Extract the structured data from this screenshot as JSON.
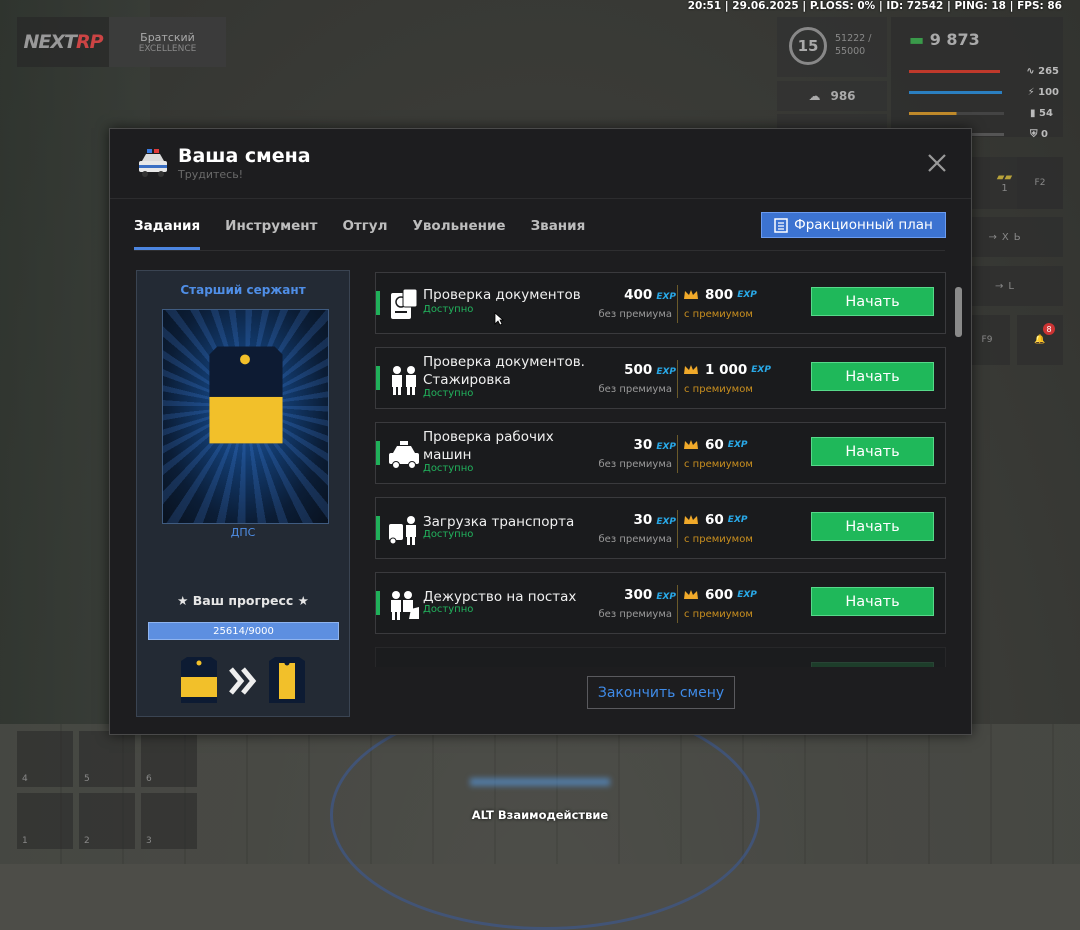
{
  "hud": {
    "top_info": "20:51 | 29.06.2025 | P.LOSS: 0% | ID: 72542 | PING: 18 | FPS: 86",
    "logo": "NEXTRP",
    "server_name": "Братский",
    "server_sub": "EXCELLENCE",
    "level": "15",
    "xp_line1": "51222 /",
    "xp_line2": "55000",
    "money": "9 873",
    "stat_health": "265",
    "stat_armor": "100",
    "stat_food": "54",
    "stat_shield": "0",
    "counter": "986",
    "slot_label_1": "1",
    "key_f2": "F2",
    "key_f9": "F9",
    "hint_x": "X",
    "hint_b": "Ь",
    "hint_l": "L",
    "badge_count": "8",
    "hotbar": [
      "4",
      "5",
      "6",
      "1",
      "2",
      "3"
    ],
    "alt_hint": "ALT Взаимодействие"
  },
  "modal": {
    "title": "Ваша смена",
    "subtitle": "Трудитесь!",
    "tabs": [
      "Задания",
      "Инструмент",
      "Отгул",
      "Увольнение",
      "Звания"
    ],
    "plan_button": "Фракционный план",
    "finish_button": "Закончить смену"
  },
  "rank": {
    "name": "Старший сержант",
    "department": "ДПС",
    "progress_label": "★ Ваш прогресс ★",
    "progress_text": "25614/9000"
  },
  "exp_unit": "EXP",
  "tasks": [
    {
      "name": "Проверка документов",
      "status": "Доступно",
      "base": "400",
      "base_label": "без премиума",
      "premium": "800",
      "premium_label": "с премиумом",
      "button": "Начать"
    },
    {
      "name": "Проверка документов. Стажировка",
      "status": "Доступно",
      "base": "500",
      "base_label": "без премиума",
      "premium": "1 000",
      "premium_label": "с премиумом",
      "button": "Начать"
    },
    {
      "name": "Проверка рабочих машин",
      "status": "Доступно",
      "base": "30",
      "base_label": "без премиума",
      "premium": "60",
      "premium_label": "с премиумом",
      "button": "Начать"
    },
    {
      "name": "Загрузка транспорта",
      "status": "Доступно",
      "base": "30",
      "base_label": "без премиума",
      "premium": "60",
      "premium_label": "с премиумом",
      "button": "Начать"
    },
    {
      "name": "Дежурство на постах",
      "status": "Доступно",
      "base": "300",
      "base_label": "без премиума",
      "premium": "600",
      "premium_label": "с премиумом",
      "button": "Начать"
    }
  ],
  "colors": {
    "accent_blue": "#3c73d1",
    "start_green": "#1fb85a",
    "available_green": "#22b35d",
    "premium_gold": "#c98f1f",
    "exp_blue": "#29a9e8"
  }
}
